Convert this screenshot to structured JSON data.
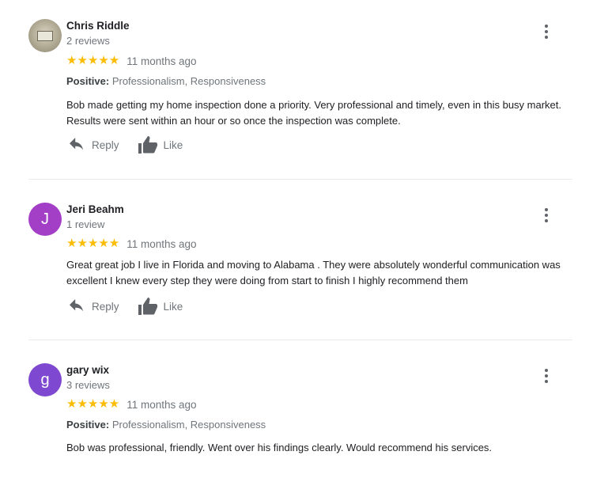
{
  "actions": {
    "reply_label": "Reply",
    "like_label": "Like"
  },
  "reviews": [
    {
      "name": "Chris Riddle",
      "review_count": "2 reviews",
      "stars": "★★★★★",
      "rating": 5,
      "time": "11 months ago",
      "positive_label": "Positive:",
      "positive_values": "Professionalism, Responsiveness",
      "text": "Bob made getting my home inspection done a priority. Very professional and timely, even in this busy market. Results were sent within an hour or so once the inspection was complete.",
      "avatar_type": "photo"
    },
    {
      "name": "Jeri Beahm",
      "review_count": "1 review",
      "stars": "★★★★★",
      "rating": 5,
      "time": "11 months ago",
      "text": "Great great job I live in Florida and moving to Alabama . They were absolutely wonderful communication was excellent I knew every step they were doing from start to finish I highly recommend them",
      "avatar_letter": "J",
      "avatar_color": "#a33ec6"
    },
    {
      "name": "gary wix",
      "review_count": "3 reviews",
      "stars": "★★★★★",
      "rating": 5,
      "time": "11 months ago",
      "positive_label": "Positive:",
      "positive_values": "Professionalism, Responsiveness",
      "text": "Bob was professional, friendly. Went over his findings clearly. Would recommend his services.",
      "avatar_letter": "g",
      "avatar_color": "#7f48d1"
    }
  ],
  "colors": {
    "star": "#fbbc04",
    "muted_text": "#70757a",
    "divider": "#e8eaed"
  },
  "icons": {
    "reply": "reply-arrow-icon",
    "like": "thumbs-up-icon",
    "more": "more-vert-icon"
  }
}
